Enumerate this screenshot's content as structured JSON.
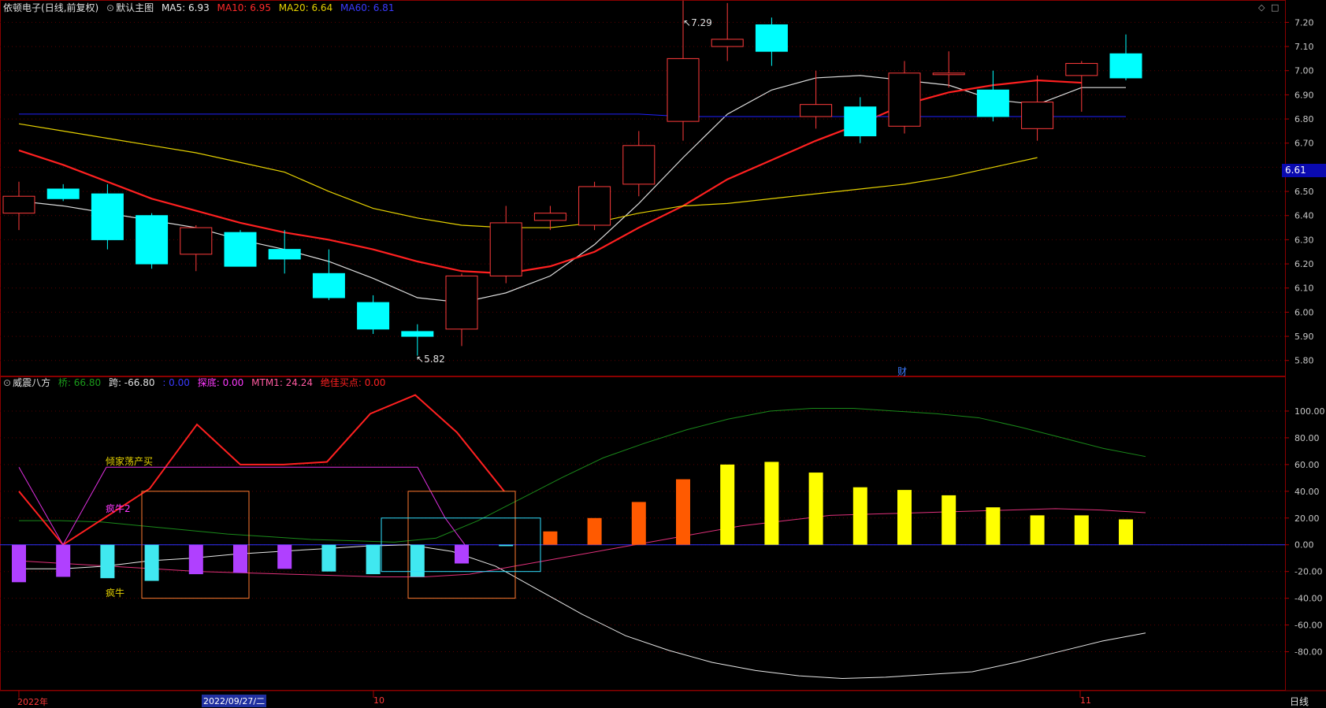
{
  "header_top": {
    "stock_name": "依顿电子",
    "mode": "(日线,前复权)",
    "main_chart": "默认主图",
    "ma5": "MA5: 6.93",
    "ma10": "MA10: 6.95",
    "ma20": "MA20: 6.64",
    "ma60": "MA60: 6.81"
  },
  "header_bottom": {
    "indicator_name": "威震八方",
    "v1": "桥: 66.80",
    "v2": "跨: -66.80",
    "v3": ": 0.00",
    "v4": "探底: 0.00",
    "v5": "MTM1: 24.24",
    "v6": "绝佳买点: 0.00"
  },
  "annotations": {
    "high_mark": "7.29",
    "low_mark": "5.82",
    "finance_tag": "财",
    "current_price": "6.61",
    "label_qingjia": "倾家荡产买",
    "label_fengniu2": "疯牛2",
    "label_fengniu": "疯牛"
  },
  "date_bar": {
    "year": "2022年",
    "cursor_date": "2022/09/27/二",
    "month_oct": "10",
    "month_nov": "11",
    "period": "日线"
  },
  "colors": {
    "bull": "#ff3b3b",
    "bear": "#00ffff",
    "ma5": "#dddddd",
    "ma10": "#ff2020",
    "ma20": "#e6d200",
    "ma60": "#2020ff",
    "grid": "#5a0000"
  },
  "chart_data": [
    {
      "type": "candlestick",
      "title": "依顿电子 (日线,前复权)",
      "ylim": [
        5.76,
        7.26
      ],
      "yticks": [
        5.8,
        5.9,
        6.0,
        6.1,
        6.2,
        6.3,
        6.4,
        6.5,
        6.6,
        6.7,
        6.8,
        6.9,
        7.0,
        7.1,
        7.2
      ],
      "candles": [
        {
          "o": 6.41,
          "h": 6.54,
          "l": 6.34,
          "c": 6.48
        },
        {
          "o": 6.51,
          "h": 6.53,
          "l": 6.46,
          "c": 6.47
        },
        {
          "o": 6.49,
          "h": 6.53,
          "l": 6.26,
          "c": 6.3
        },
        {
          "o": 6.4,
          "h": 6.41,
          "l": 6.18,
          "c": 6.2
        },
        {
          "o": 6.24,
          "h": 6.36,
          "l": 6.17,
          "c": 6.35
        },
        {
          "o": 6.33,
          "h": 6.34,
          "l": 6.19,
          "c": 6.19
        },
        {
          "o": 6.26,
          "h": 6.34,
          "l": 6.16,
          "c": 6.22
        },
        {
          "o": 6.16,
          "h": 6.26,
          "l": 6.05,
          "c": 6.06
        },
        {
          "o": 6.04,
          "h": 6.07,
          "l": 5.91,
          "c": 5.93
        },
        {
          "o": 5.92,
          "h": 5.95,
          "l": 5.82,
          "c": 5.9
        },
        {
          "o": 5.93,
          "h": 6.16,
          "l": 5.86,
          "c": 6.15
        },
        {
          "o": 6.15,
          "h": 6.44,
          "l": 6.12,
          "c": 6.37
        },
        {
          "o": 6.38,
          "h": 6.44,
          "l": 6.34,
          "c": 6.41
        },
        {
          "o": 6.36,
          "h": 6.54,
          "l": 6.34,
          "c": 6.52
        },
        {
          "o": 6.53,
          "h": 6.75,
          "l": 6.48,
          "c": 6.69
        },
        {
          "o": 6.79,
          "h": 7.29,
          "l": 6.71,
          "c": 7.05
        },
        {
          "o": 7.1,
          "h": 7.28,
          "l": 7.04,
          "c": 7.13
        },
        {
          "o": 7.19,
          "h": 7.22,
          "l": 7.02,
          "c": 7.08
        },
        {
          "o": 6.81,
          "h": 7.0,
          "l": 6.76,
          "c": 6.86
        },
        {
          "o": 6.85,
          "h": 6.89,
          "l": 6.7,
          "c": 6.73
        },
        {
          "o": 6.77,
          "h": 7.04,
          "l": 6.74,
          "c": 6.99
        },
        {
          "o": 6.99,
          "h": 7.08,
          "l": 6.93,
          "c": 6.99
        },
        {
          "o": 6.92,
          "h": 7.0,
          "l": 6.79,
          "c": 6.81
        },
        {
          "o": 6.76,
          "h": 6.98,
          "l": 6.71,
          "c": 6.87
        },
        {
          "o": 6.98,
          "h": 7.04,
          "l": 6.83,
          "c": 7.03
        },
        {
          "o": 7.07,
          "h": 7.15,
          "l": 6.96,
          "c": 6.97
        }
      ],
      "series": [
        {
          "name": "MA5",
          "values": [
            6.46,
            6.44,
            6.41,
            6.38,
            6.35,
            6.3,
            6.26,
            6.21,
            6.14,
            6.06,
            6.04,
            6.08,
            6.15,
            6.28,
            6.45,
            6.64,
            6.82,
            6.92,
            6.97,
            6.98,
            6.96,
            6.94,
            6.88,
            6.86,
            6.93,
            6.93
          ]
        },
        {
          "name": "MA10",
          "values": [
            6.67,
            6.61,
            6.54,
            6.47,
            6.42,
            6.37,
            6.33,
            6.3,
            6.26,
            6.21,
            6.17,
            6.16,
            6.19,
            6.25,
            6.35,
            6.44,
            6.55,
            6.63,
            6.71,
            6.78,
            6.86,
            6.91,
            6.94,
            6.96,
            6.95
          ]
        },
        {
          "name": "MA20",
          "values": [
            6.78,
            6.75,
            6.72,
            6.69,
            6.66,
            6.62,
            6.58,
            6.5,
            6.43,
            6.39,
            6.36,
            6.35,
            6.35,
            6.37,
            6.41,
            6.44,
            6.45,
            6.47,
            6.49,
            6.51,
            6.53,
            6.56,
            6.6,
            6.64
          ]
        },
        {
          "name": "MA60",
          "values": [
            6.82,
            6.82,
            6.82,
            6.82,
            6.82,
            6.82,
            6.82,
            6.82,
            6.82,
            6.82,
            6.82,
            6.82,
            6.82,
            6.82,
            6.82,
            6.81,
            6.81,
            6.81,
            6.81,
            6.81,
            6.81,
            6.81,
            6.81,
            6.81,
            6.81,
            6.81
          ]
        }
      ]
    },
    {
      "type": "bar",
      "title": "威震八方",
      "ylim": [
        -105,
        120
      ],
      "yticks": [
        100,
        80,
        60,
        40,
        20,
        0,
        -20,
        -40,
        -60,
        -80
      ],
      "bars": [
        -28,
        -24,
        -25,
        -27,
        -22,
        -21,
        -18,
        -20,
        -22,
        -24,
        -14,
        -1,
        10,
        20,
        32,
        49,
        60,
        62,
        54,
        43,
        41,
        37,
        28,
        22,
        22,
        19
      ],
      "series": [
        {
          "name": "桥",
          "values": [
            18,
            18,
            17,
            14,
            11,
            8,
            6,
            4,
            3,
            2,
            5,
            18,
            34,
            50,
            65,
            76,
            86,
            94,
            100,
            102,
            102,
            100,
            98,
            95,
            88,
            80,
            72,
            66
          ]
        },
        {
          "name": "跨",
          "values": [
            -18,
            -18,
            -16,
            -12,
            -10,
            -7,
            -5,
            -3,
            -1,
            0,
            -5,
            -16,
            -34,
            -52,
            -68,
            -79,
            -88,
            -94,
            -98,
            -100,
            -99,
            -97,
            -95,
            -88,
            -80,
            -72,
            -66
          ]
        },
        {
          "name": "MTM1",
          "values": [
            -12,
            -14,
            -16,
            -18,
            -20,
            -21,
            -22,
            -23,
            -24,
            -24,
            -22,
            -16,
            -10,
            -4,
            2,
            8,
            14,
            18,
            22,
            23,
            24,
            25,
            26,
            27,
            26,
            24
          ]
        },
        {
          "name": "red_zigzag",
          "values": [
            40,
            0,
            42,
            90,
            60,
            60,
            62,
            98,
            112,
            84,
            40
          ]
        },
        {
          "name": "magenta_line",
          "values": [
            58,
            0,
            58,
            58,
            58,
            58,
            58,
            58,
            58,
            20,
            0
          ]
        }
      ]
    }
  ]
}
